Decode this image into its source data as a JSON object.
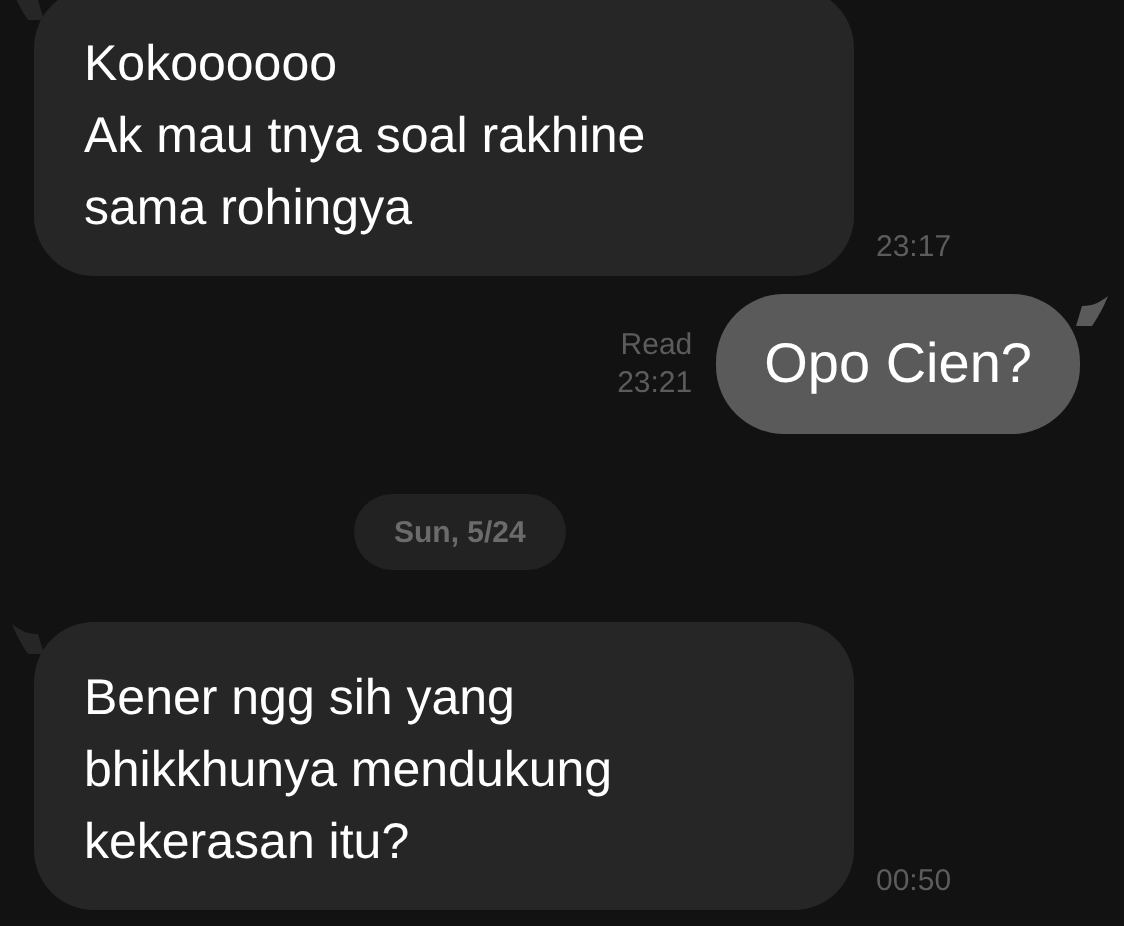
{
  "messages": [
    {
      "kind": "incoming",
      "text": "Kokoooooo\nAk mau tnya soal rakhine\nsama rohingya",
      "time": "23:17"
    },
    {
      "kind": "outgoing",
      "text": "Opo Cien?",
      "read": "Read",
      "time": "23:21"
    },
    {
      "kind": "date",
      "text": "Sun, 5/24"
    },
    {
      "kind": "incoming",
      "text": "Bener ngg sih yang\nbhikkhunya mendukung\nkekerasan itu?",
      "time": "00:50"
    }
  ]
}
